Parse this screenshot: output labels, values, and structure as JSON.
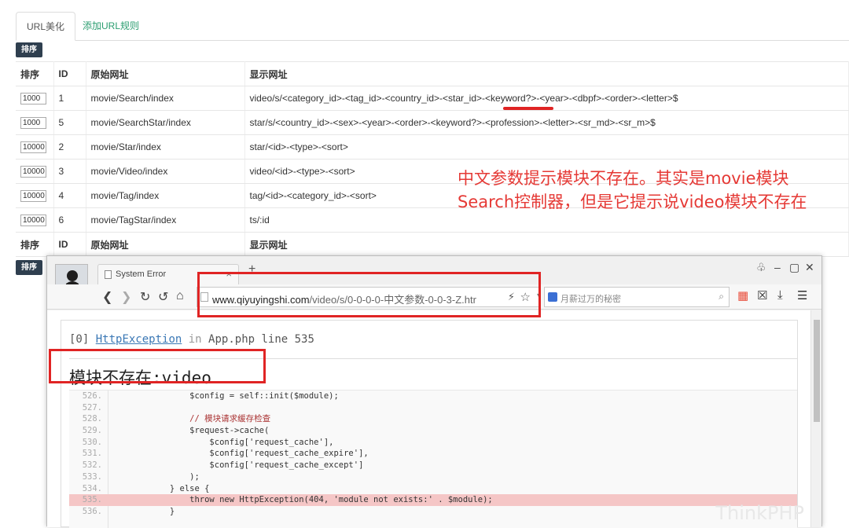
{
  "tabs": [
    {
      "label": "URL美化"
    },
    {
      "label": "添加URL规则"
    }
  ],
  "sort_button": "排序",
  "table": {
    "headers": [
      "排序",
      "ID",
      "原始网址",
      "显示网址"
    ],
    "rows": [
      {
        "sort": "1000",
        "id": "1",
        "orig": "movie/Search/index",
        "display": "video/s/<category_id>-<tag_id>-<country_id>-<star_id>-<keyword?>-<year>-<dbpf>-<order>-<letter>$"
      },
      {
        "sort": "1000",
        "id": "5",
        "orig": "movie/SearchStar/index",
        "display": "star/s/<country_id>-<sex>-<year>-<order>-<keyword?>-<profession>-<letter>-<sr_md>-<sr_m>$"
      },
      {
        "sort": "10000",
        "id": "2",
        "orig": "movie/Star/index",
        "display": "star/<id>-<type>-<sort>"
      },
      {
        "sort": "10000",
        "id": "3",
        "orig": "movie/Video/index",
        "display": "video/<id>-<type>-<sort>"
      },
      {
        "sort": "10000",
        "id": "4",
        "orig": "movie/Tag/index",
        "display": "tag/<id>-<category_id>-<sort>"
      },
      {
        "sort": "10000",
        "id": "6",
        "orig": "movie/TagStar/index",
        "display": "ts/:id"
      }
    ],
    "footer": [
      "排序",
      "ID",
      "原始网址",
      "显示网址"
    ]
  },
  "annotation": {
    "line1": "中文参数提示模块不存在。其实是movie模块",
    "line2": "Search控制器，但是它提示说video模块不存在"
  },
  "browser": {
    "tab_title": "System Error",
    "tab_close": "×",
    "new_tab": "+",
    "url_host": "www.qiyuyingshi.com",
    "url_rest": "/video/s/0-0-0-0-中文参数-0-0-3-Z.htr",
    "search_placeholder": "月薪过万的秘密",
    "error": {
      "index": "[0]",
      "class": "HttpException",
      "in_word": "in",
      "location": "App.php line 535",
      "message": "模块不存在:video"
    },
    "code": [
      {
        "ln": "526.",
        "src": "                $config = self::init($module);"
      },
      {
        "ln": "527.",
        "src": ""
      },
      {
        "ln": "528.",
        "src": "                // 模块请求缓存检查"
      },
      {
        "ln": "529.",
        "src": "                $request->cache("
      },
      {
        "ln": "530.",
        "src": "                    $config['request_cache'],"
      },
      {
        "ln": "531.",
        "src": "                    $config['request_cache_expire'],"
      },
      {
        "ln": "532.",
        "src": "                    $config['request_cache_except']"
      },
      {
        "ln": "533.",
        "src": "                );"
      },
      {
        "ln": "534.",
        "src": "            } else {"
      },
      {
        "ln": "535.",
        "src": "                throw new HttpException(404, 'module not exists:' . $module);"
      },
      {
        "ln": "536.",
        "src": "            }"
      }
    ],
    "highlight_line": "535.",
    "watermark": "ThinkPHP"
  },
  "colors": {
    "accent_red": "#e02424",
    "annotation_red": "#e53935",
    "link_green": "#2a9d6f",
    "dark_button": "#2f3f4f"
  }
}
